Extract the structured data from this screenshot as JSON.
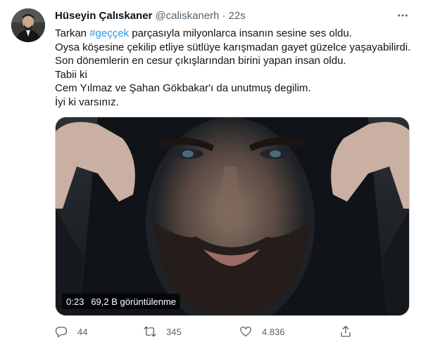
{
  "tweet": {
    "author_name": "Hüseyin Çalıskaner",
    "handle": "@caliskanerh",
    "separator": "·",
    "time": "22s",
    "text": {
      "line1_prefix": "Tarkan ",
      "line1_hashtag": "#geççek",
      "line1_suffix": " parçasıyla milyonlarca insanın sesine ses oldu.",
      "line2": "Oysa köşesine çekilip etliye sütlüye karışmadan gayet güzelce yaşayabilirdi.",
      "line3": "Son dönemlerin en cesur çıkışlarından birini yapan insan oldu.",
      "line4": "Tabii ki",
      "line5": "Cem Yılmaz ve Şahan Gökbakar'ı da unutmuş degilim.",
      "line6": "İyi ki varsınız."
    },
    "video": {
      "duration": "0:23",
      "views": "69,2 B görüntülenme"
    },
    "actions": {
      "reply_count": "44",
      "retweet_count": "345",
      "like_count": "4.836"
    },
    "icons": {
      "reply": "reply-icon",
      "retweet": "retweet-icon",
      "like": "heart-icon",
      "share": "share-icon",
      "more": "more-icon"
    },
    "colors": {
      "hashtag": "#1d9bf0",
      "secondary_text": "#536471"
    }
  }
}
